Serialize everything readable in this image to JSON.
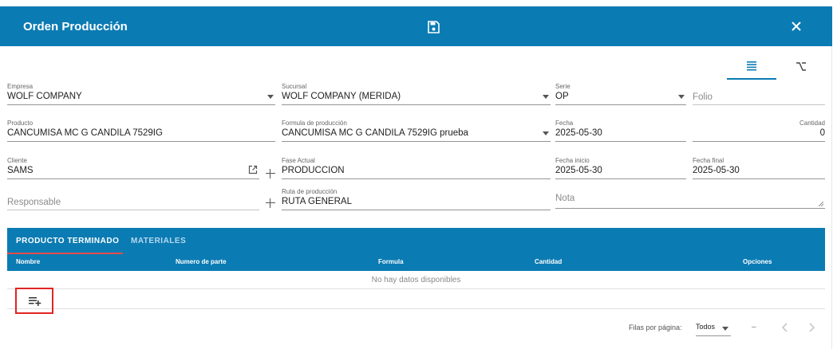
{
  "header": {
    "title": "Orden Producción"
  },
  "icons": {
    "save": "save-icon",
    "close": "close-icon",
    "list": "list-view-icon",
    "tree": "option-key-icon",
    "add_row": "playlist-add-icon",
    "external": "open-in-new-icon"
  },
  "colors": {
    "primary": "#0b7bb3",
    "tab_indicator": "#e64a4a",
    "highlight": "#e02424"
  },
  "form": {
    "empresa": {
      "label": "Empresa",
      "value": "WOLF COMPANY"
    },
    "sucursal": {
      "label": "Sucursal",
      "value": "WOLF COMPANY (MERIDA)"
    },
    "serie": {
      "label": "Serie",
      "value": "OP"
    },
    "folio": {
      "placeholder": "Folio"
    },
    "producto": {
      "label": "Producto",
      "value": "CANCUMISA MC G CANDILA 7529IG"
    },
    "formula": {
      "label": "Formula de producción",
      "value": "CANCUMISA MC G CANDILA 7529IG prueba"
    },
    "fecha": {
      "label": "Fecha",
      "value": "2025-05-30"
    },
    "cantidad": {
      "label": "Cantidad",
      "value": "0"
    },
    "cliente": {
      "label": "Cliente",
      "value": "SAMS"
    },
    "fase": {
      "label": "Fase Actual",
      "value": "PRODUCCION"
    },
    "fecha_inicio": {
      "label": "Fecha inicio",
      "value": "2025-05-30"
    },
    "fecha_final": {
      "label": "Fecha final",
      "value": "2025-05-30"
    },
    "responsable": {
      "placeholder": "Responsable"
    },
    "ruta": {
      "label": "Ruta de producción",
      "value": "RUTA GENERAL"
    },
    "nota": {
      "placeholder": "Nota"
    }
  },
  "tabs": [
    {
      "label": "PRODUCTO TERMINADO"
    },
    {
      "label": "MATERIALES"
    }
  ],
  "table": {
    "headers": [
      "Nombre",
      "Numero de parte",
      "Formula",
      "Cantidad",
      "Opciones"
    ],
    "empty_text": "No hay datos disponibles"
  },
  "pagination": {
    "rows_per_page_label": "Filas por página:",
    "rows_per_page_value": "Todos",
    "range_text": "–"
  }
}
